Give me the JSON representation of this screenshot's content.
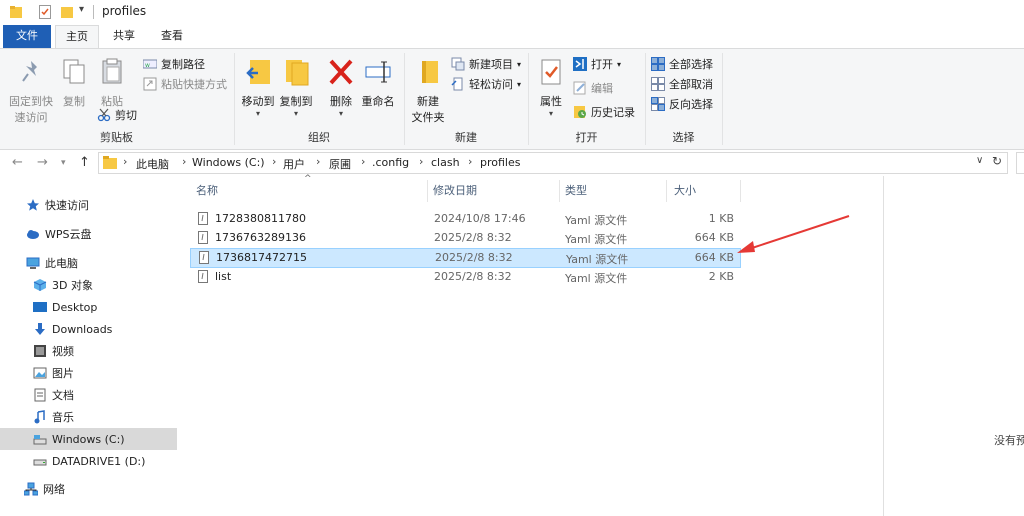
{
  "window": {
    "title": "profiles"
  },
  "ribbon_tabs": [
    "文件",
    "主页",
    "共享",
    "查看"
  ],
  "ribbon": {
    "clipboard": {
      "pin_label_1": "固定到快",
      "pin_label_2": "速访问",
      "copy_label": "复制",
      "paste_label": "粘贴",
      "copy_path_label": "复制路径",
      "paste_shortcut_label": "粘贴快捷方式",
      "cut_label": "剪切",
      "group_label": "剪贴板"
    },
    "organize": {
      "move_to_label": "移动到",
      "copy_to_label": "复制到",
      "delete_label": "删除",
      "rename_label": "重命名",
      "group_label": "组织"
    },
    "new": {
      "new_folder_label_1": "新建",
      "new_folder_label_2": "文件夹",
      "new_item_label": "新建项目",
      "easy_access_label": "轻松访问",
      "group_label": "新建"
    },
    "open": {
      "properties_label": "属性",
      "open_label": "打开",
      "edit_label": "编辑",
      "history_label": "历史记录",
      "group_label": "打开"
    },
    "select": {
      "select_all_label": "全部选择",
      "select_none_label": "全部取消",
      "invert_label": "反向选择",
      "group_label": "选择"
    }
  },
  "address": {
    "crumbs": [
      "此电脑",
      "Windows (C:)",
      "用户",
      "原圃",
      ".config",
      "clash",
      "profiles"
    ]
  },
  "sidebar": {
    "items": [
      {
        "label": "快速访问",
        "icon": "star-icon"
      },
      {
        "label": "WPS云盘",
        "icon": "cloud-icon"
      },
      {
        "label": "此电脑",
        "icon": "pc-icon"
      },
      {
        "label": "3D 对象",
        "icon": "cube-icon"
      },
      {
        "label": "Desktop",
        "icon": "desktop-icon"
      },
      {
        "label": "Downloads",
        "icon": "download-icon"
      },
      {
        "label": "视频",
        "icon": "video-icon"
      },
      {
        "label": "图片",
        "icon": "picture-icon"
      },
      {
        "label": "文档",
        "icon": "document-icon"
      },
      {
        "label": "音乐",
        "icon": "music-icon"
      },
      {
        "label": "Windows (C:)",
        "icon": "drive-icon"
      },
      {
        "label": "DATADRIVE1 (D:)",
        "icon": "drive-icon"
      },
      {
        "label": "网络",
        "icon": "network-icon"
      }
    ]
  },
  "file_list": {
    "columns": [
      "名称",
      "修改日期",
      "类型",
      "大小"
    ],
    "rows": [
      {
        "name": "1728380811780",
        "date": "2024/10/8 17:46",
        "type": "Yaml 源文件",
        "size": "1 KB"
      },
      {
        "name": "1736763289136",
        "date": "2025/2/8 8:32",
        "type": "Yaml 源文件",
        "size": "664 KB"
      },
      {
        "name": "1736817472715",
        "date": "2025/2/8 8:32",
        "type": "Yaml 源文件",
        "size": "664 KB"
      },
      {
        "name": "list",
        "date": "2025/2/8 8:32",
        "type": "Yaml 源文件",
        "size": "2 KB"
      }
    ]
  },
  "preview": {
    "text": "没有预"
  },
  "colors": {
    "accent": "#1f5fb5",
    "selection": "#cce8ff",
    "arrow": "#e53935"
  }
}
